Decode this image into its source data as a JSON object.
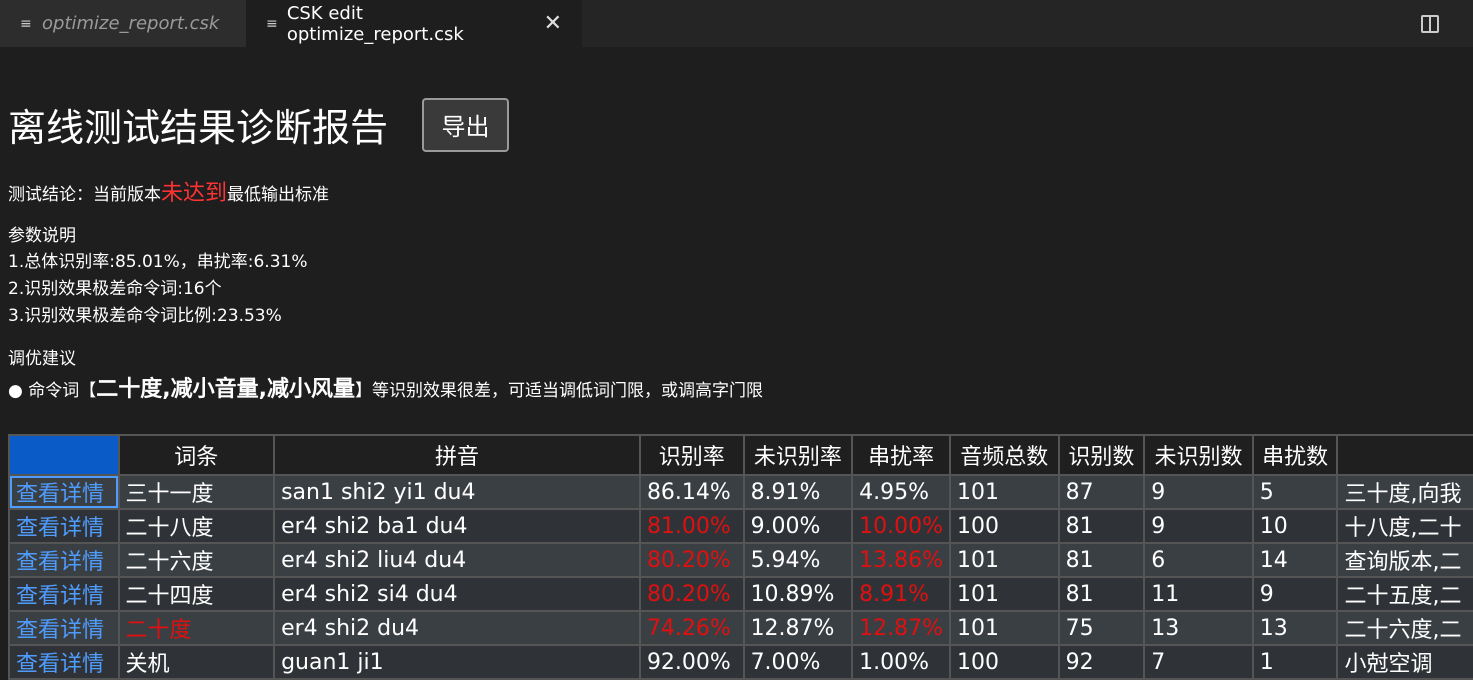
{
  "tabs": [
    {
      "label": "optimize_report.csk",
      "active": false
    },
    {
      "label": "CSK edit optimize_report.csk",
      "active": true
    }
  ],
  "report": {
    "title": "离线测试结果诊断报告",
    "export_label": "导出",
    "conclusion_prefix": "测试结论：当前版本",
    "conclusion_status": "未达到",
    "conclusion_suffix": "最低输出标准",
    "params_heading": "参数说明",
    "params": [
      "1.总体识别率:85.01%，串扰率:6.31%",
      "2.识别效果极差命令词:16个",
      "3.识别效果极差命令词比例:23.53%"
    ],
    "tuning_heading": "调优建议",
    "tuning_prefix": "● 命令词【",
    "tuning_words": "二十度,减小音量,减小风量",
    "tuning_suffix": "】等识别效果很差，可适当调低词门限，或调高字门限"
  },
  "table": {
    "headers": [
      "",
      "词条",
      "拼音",
      "识别率",
      "未识别率",
      "串扰率",
      "音频总数",
      "识别数",
      "未识别数",
      "串扰数",
      ""
    ],
    "detail_label": "查看详情",
    "rows": [
      {
        "word": "三十一度",
        "pinyin": "san1 shi2 yi1 du4",
        "rate": "86.14%",
        "miss": "8.91%",
        "cross": "4.95%",
        "total": "101",
        "hit": "87",
        "missed": "9",
        "crossed": "5",
        "extra": "三十度,向我",
        "word_red": false,
        "rate_red": false,
        "cross_red": false
      },
      {
        "word": "二十八度",
        "pinyin": "er4 shi2 ba1 du4",
        "rate": "81.00%",
        "miss": "9.00%",
        "cross": "10.00%",
        "total": "100",
        "hit": "81",
        "missed": "9",
        "crossed": "10",
        "extra": "十八度,二十",
        "word_red": false,
        "rate_red": true,
        "cross_red": true
      },
      {
        "word": "二十六度",
        "pinyin": "er4 shi2 liu4 du4",
        "rate": "80.20%",
        "miss": "5.94%",
        "cross": "13.86%",
        "total": "101",
        "hit": "81",
        "missed": "6",
        "crossed": "14",
        "extra": "查询版本,二",
        "word_red": false,
        "rate_red": true,
        "cross_red": true
      },
      {
        "word": "二十四度",
        "pinyin": "er4 shi2 si4 du4",
        "rate": "80.20%",
        "miss": "10.89%",
        "cross": "8.91%",
        "total": "101",
        "hit": "81",
        "missed": "11",
        "crossed": "9",
        "extra": "二十五度,二",
        "word_red": false,
        "rate_red": true,
        "cross_red": true
      },
      {
        "word": "二十度",
        "pinyin": "er4 shi2 du4",
        "rate": "74.26%",
        "miss": "12.87%",
        "cross": "12.87%",
        "total": "101",
        "hit": "75",
        "missed": "13",
        "crossed": "13",
        "extra": "二十六度,二",
        "word_red": true,
        "rate_red": true,
        "cross_red": true
      },
      {
        "word": "关机",
        "pinyin": "guan1 ji1",
        "rate": "92.00%",
        "miss": "7.00%",
        "cross": "1.00%",
        "total": "100",
        "hit": "92",
        "missed": "7",
        "crossed": "1",
        "extra": "小尅空调",
        "word_red": false,
        "rate_red": false,
        "cross_red": false
      }
    ]
  }
}
